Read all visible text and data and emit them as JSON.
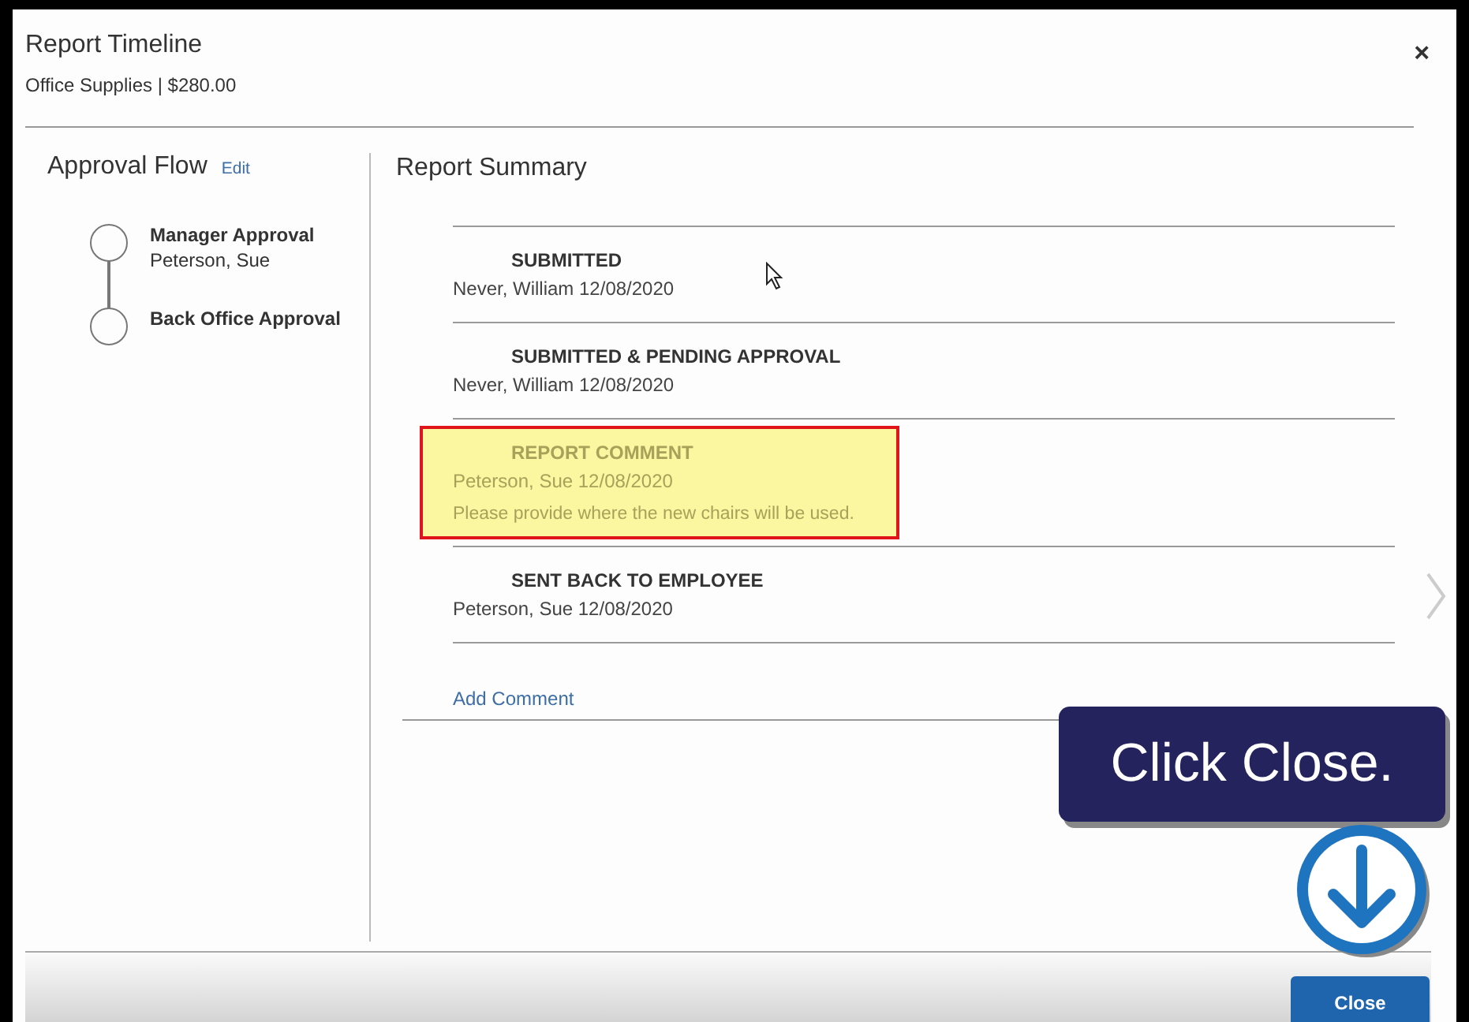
{
  "dialog": {
    "title": "Report Timeline",
    "subtitle": "Office Supplies | $280.00",
    "close_glyph": "×"
  },
  "approval_flow": {
    "heading": "Approval Flow",
    "edit_link": "Edit",
    "steps": [
      {
        "title": "Manager Approval",
        "approver": "Peterson, Sue"
      },
      {
        "title": "Back Office Approval"
      }
    ]
  },
  "report_summary": {
    "heading": "Report Summary",
    "events": [
      {
        "title": "SUBMITTED",
        "meta": "Never, William 12/08/2020",
        "highlighted": false
      },
      {
        "title": "SUBMITTED & PENDING APPROVAL",
        "meta": "Never, William 12/08/2020",
        "highlighted": false
      },
      {
        "title": "REPORT COMMENT",
        "meta": "Peterson, Sue 12/08/2020",
        "comment": "Please provide where the new chairs will be used.",
        "highlighted": true
      },
      {
        "title": "SENT BACK TO EMPLOYEE",
        "meta": "Peterson, Sue 12/08/2020",
        "highlighted": false
      }
    ],
    "add_comment": "Add Comment"
  },
  "footer": {
    "close_button": "Close"
  },
  "tutorial": {
    "callout": "Click Close."
  }
}
